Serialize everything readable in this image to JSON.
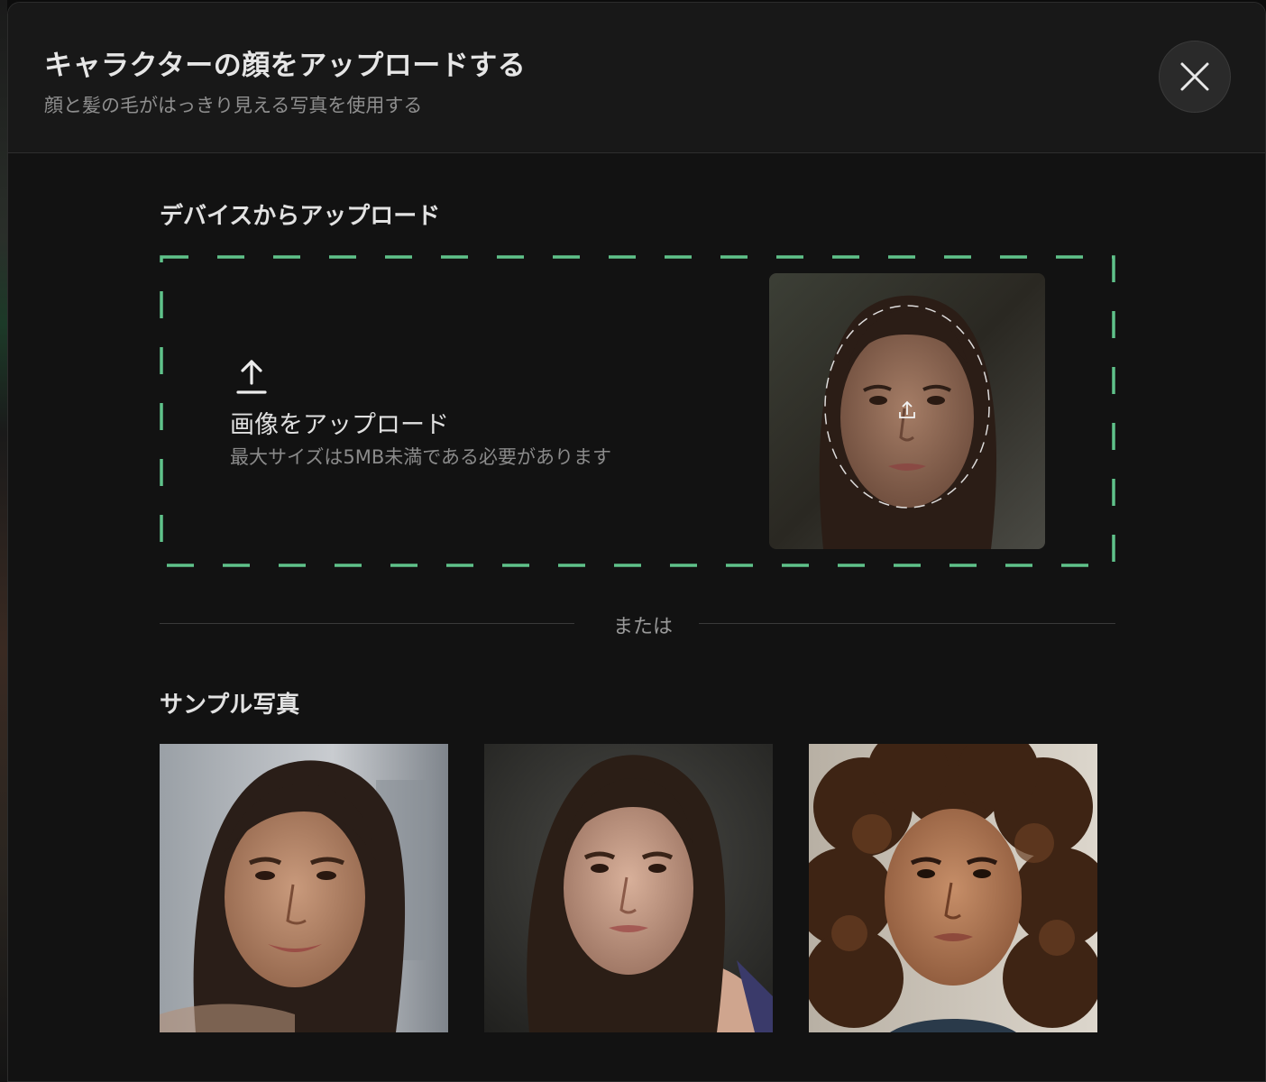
{
  "modal": {
    "title": "キャラクターの顔をアップロードする",
    "subtitle": "顔と髪の毛がはっきり見える写真を使用する"
  },
  "upload_section": {
    "heading": "デバイスからアップロード",
    "label": "画像をアップロード",
    "hint": "最大サイズは5MB未満である必要があります",
    "border_color": "#5fc28a"
  },
  "divider": {
    "text": "または"
  },
  "samples": {
    "heading": "サンプル写真",
    "photos": [
      {
        "name": "sample-photo-1",
        "icon": "portrait-smiling-woman"
      },
      {
        "name": "sample-photo-2",
        "icon": "portrait-young-woman"
      },
      {
        "name": "sample-photo-3",
        "icon": "portrait-curly-hair-woman"
      }
    ]
  },
  "icons": {
    "close": "close-icon",
    "upload": "upload-arrow-icon",
    "face_upload": "face-upload-icon"
  }
}
